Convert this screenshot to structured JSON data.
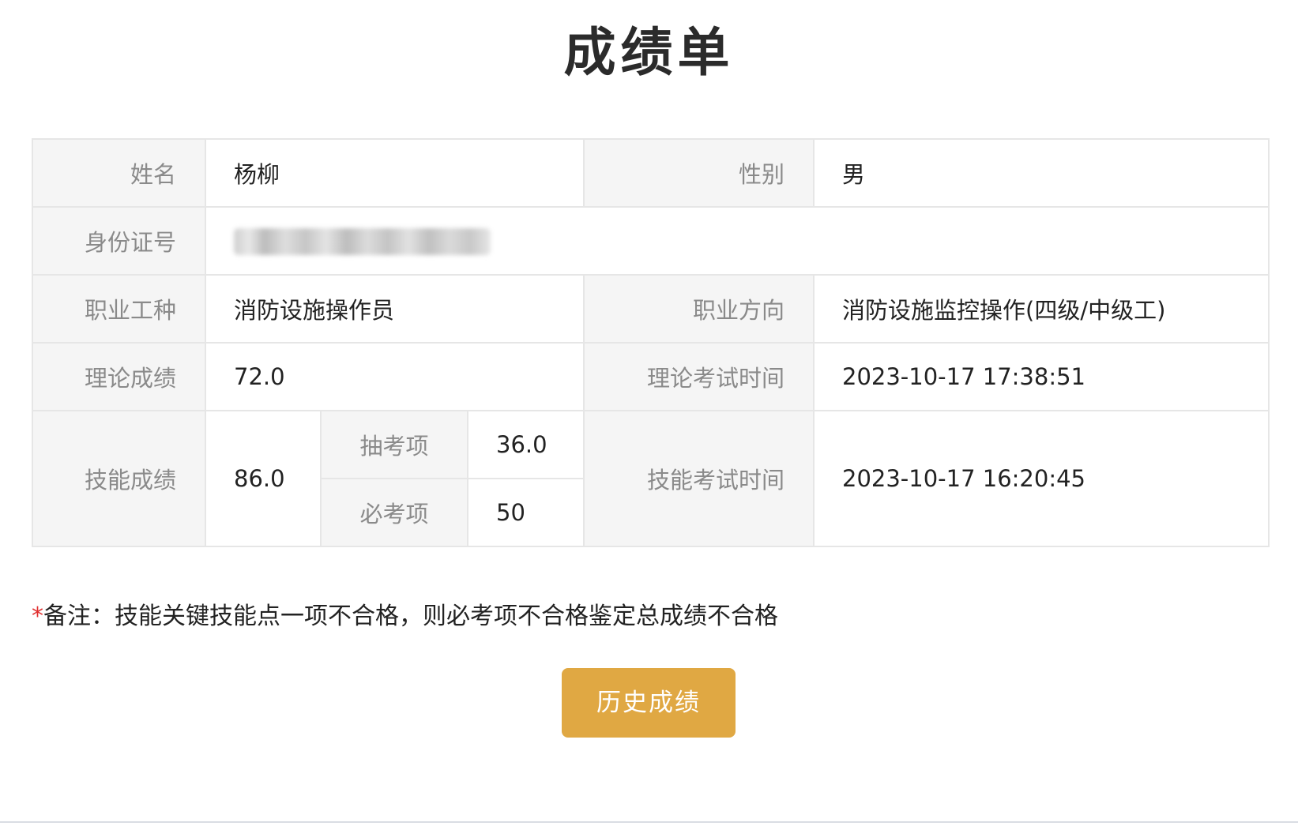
{
  "page": {
    "title": "成绩单"
  },
  "table": {
    "name_label": "姓名",
    "name_value": "杨柳",
    "gender_label": "性别",
    "gender_value": "男",
    "id_label": "身份证号",
    "occupation_label": "职业工种",
    "occupation_value": "消防设施操作员",
    "direction_label": "职业方向",
    "direction_value": "消防设施监控操作(四级/中级工)",
    "theory_score_label": "理论成绩",
    "theory_score_value": "72.0",
    "theory_time_label": "理论考试时间",
    "theory_time_value": "2023-10-17 17:38:51",
    "skill_score_label": "技能成绩",
    "skill_score_value": "86.0",
    "random_item_label": "抽考项",
    "random_item_value": "36.0",
    "required_item_label": "必考项",
    "required_item_value": "50",
    "skill_time_label": "技能考试时间",
    "skill_time_value": "2023-10-17 16:20:45"
  },
  "note": {
    "asterisk": "*",
    "text": "备注：技能关键技能点一项不合格，则必考项不合格鉴定总成绩不合格"
  },
  "buttons": {
    "history_label": "历史成绩"
  },
  "colors": {
    "accent_button": "#e0a843",
    "skill_score_blue": "#4a8ac9",
    "asterisk_red": "#e02e2e",
    "label_bg": "#f5f5f5"
  }
}
